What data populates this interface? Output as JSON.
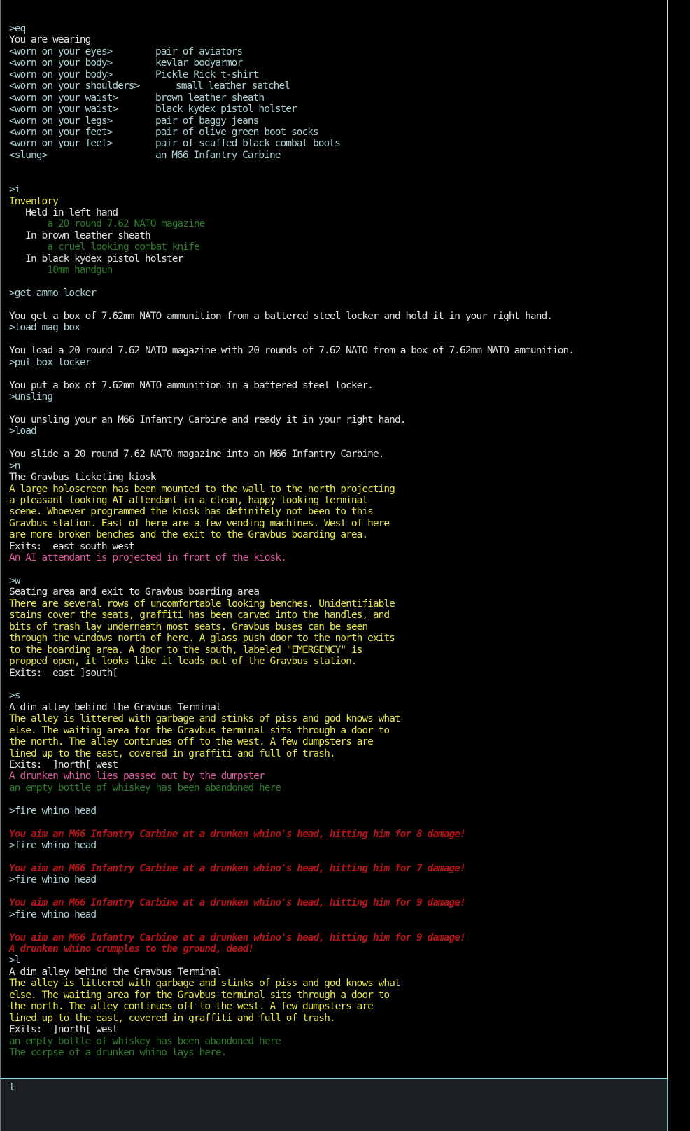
{
  "output": [
    {
      "style": "cmd",
      "text": ">eq"
    },
    {
      "style": "white",
      "text": "You are wearing"
    },
    {
      "style": "eq",
      "slot": "<worn on your eyes>",
      "item": "pair of aviators"
    },
    {
      "style": "eq",
      "slot": "<worn on your body>",
      "item": "kevlar bodyarmor"
    },
    {
      "style": "eq",
      "slot": "<worn on your body>",
      "item": "Pickle Rick t-shirt"
    },
    {
      "style": "eq",
      "slot": "<worn on your shoulders>",
      "item": "small leather satchel"
    },
    {
      "style": "eq",
      "slot": "<worn on your waist>",
      "item": "brown leather sheath"
    },
    {
      "style": "eq",
      "slot": "<worn on your waist>",
      "item": "black kydex pistol holster"
    },
    {
      "style": "eq",
      "slot": "<worn on your legs>",
      "item": "pair of baggy jeans"
    },
    {
      "style": "eq",
      "slot": "<worn on your feet>",
      "item": "pair of olive green boot socks"
    },
    {
      "style": "eq",
      "slot": "<worn on your feet>",
      "item": "pair of scuffed black combat boots"
    },
    {
      "style": "eq",
      "slot": "<slung>",
      "item": "an M66 Infantry Carbine"
    },
    {
      "style": "cmd",
      "text": ""
    },
    {
      "style": "cmd",
      "text": ""
    },
    {
      "style": "cmd",
      "text": ">i"
    },
    {
      "style": "yellow",
      "text": "Inventory"
    },
    {
      "style": "white",
      "text": "   Held in left hand"
    },
    {
      "style": "green",
      "text": "       a 20 round 7.62 NATO magazine"
    },
    {
      "style": "white",
      "text": "   In brown leather sheath"
    },
    {
      "style": "green",
      "text": "       a cruel looking combat knife"
    },
    {
      "style": "white",
      "text": "   In black kydex pistol holster"
    },
    {
      "style": "green",
      "text": "       10mm handgun"
    },
    {
      "style": "cmd",
      "text": ""
    },
    {
      "style": "cmd",
      "text": ">get ammo locker"
    },
    {
      "style": "cmd",
      "text": ""
    },
    {
      "style": "white",
      "text": "You get a box of 7.62mm NATO ammunition from a battered steel locker and hold it in your right hand."
    },
    {
      "style": "cmd",
      "text": ">load mag box"
    },
    {
      "style": "cmd",
      "text": ""
    },
    {
      "style": "white",
      "text": "You load a 20 round 7.62 NATO magazine with 20 rounds of 7.62 NATO from a box of 7.62mm NATO ammunition."
    },
    {
      "style": "cmd",
      "text": ">put box locker"
    },
    {
      "style": "cmd",
      "text": ""
    },
    {
      "style": "white",
      "text": "You put a box of 7.62mm NATO ammunition in a battered steel locker."
    },
    {
      "style": "cmd",
      "text": ">unsling"
    },
    {
      "style": "cmd",
      "text": ""
    },
    {
      "style": "white",
      "text": "You unsling your an M66 Infantry Carbine and ready it in your right hand."
    },
    {
      "style": "cmd",
      "text": ">load"
    },
    {
      "style": "cmd",
      "text": ""
    },
    {
      "style": "white",
      "text": "You slide a 20 round 7.62 NATO magazine into an M66 Infantry Carbine."
    },
    {
      "style": "cmd",
      "text": ">n"
    },
    {
      "style": "white",
      "text": "The Gravbus ticketing kiosk"
    },
    {
      "style": "yellow",
      "text": "A large holoscreen has been mounted to the wall to the north projecting"
    },
    {
      "style": "yellow",
      "text": "a pleasant looking AI attendant in a clean, happy looking terminal"
    },
    {
      "style": "yellow",
      "text": "scene. Whoever programmed the kiosk has definitely not been to this"
    },
    {
      "style": "yellow",
      "text": "Gravbus station. East of here are a few vending machines. West of here"
    },
    {
      "style": "yellow",
      "text": "are more broken benches and the exit to the Gravbus boarding area."
    },
    {
      "style": "white",
      "text": "Exits:  east south west"
    },
    {
      "style": "pink",
      "text": "An AI attendant is projected in front of the kiosk."
    },
    {
      "style": "cmd",
      "text": ""
    },
    {
      "style": "cmd",
      "text": ">w"
    },
    {
      "style": "white",
      "text": "Seating area and exit to Gravbus boarding area"
    },
    {
      "style": "yellow",
      "text": "There are several rows of uncomfortable looking benches. Unidentifiable"
    },
    {
      "style": "yellow",
      "text": "stains cover the seats, graffiti has been carved into the handles, and"
    },
    {
      "style": "yellow",
      "text": "bits of trash lay underneath most seats. Gravbus buses can be seen"
    },
    {
      "style": "yellow",
      "text": "through the windows north of here. A glass push door to the north exits"
    },
    {
      "style": "yellow",
      "text": "to the boarding area. A door to the south, labeled \"EMERGENCY\" is"
    },
    {
      "style": "yellow",
      "text": "propped open, it looks like it leads out of the Gravbus station."
    },
    {
      "style": "white",
      "text": "Exits:  east ]south["
    },
    {
      "style": "cmd",
      "text": ""
    },
    {
      "style": "cmd",
      "text": ">s"
    },
    {
      "style": "white",
      "text": "A dim alley behind the Gravbus Terminal"
    },
    {
      "style": "yellow",
      "text": "The alley is littered with garbage and stinks of piss and god knows what"
    },
    {
      "style": "yellow",
      "text": "else. The waiting area for the Gravbus terminal sits through a door to"
    },
    {
      "style": "yellow",
      "text": "the north. The alley continues off to the west. A few dumpsters are"
    },
    {
      "style": "yellow",
      "text": "lined up to the east, covered in graffiti and full of trash."
    },
    {
      "style": "white",
      "text": "Exits:  ]north[ west"
    },
    {
      "style": "pink",
      "text": "A drunken whino lies passed out by the dumpster"
    },
    {
      "style": "green",
      "text": "an empty bottle of whiskey has been abandoned here"
    },
    {
      "style": "cmd",
      "text": ""
    },
    {
      "style": "cmd",
      "text": ">fire whino head"
    },
    {
      "style": "cmd",
      "text": ""
    },
    {
      "style": "red",
      "text": "You aim an M66 Infantry Carbine at a drunken whino's head, hitting him for 8 damage!"
    },
    {
      "style": "cmd",
      "text": ">fire whino head"
    },
    {
      "style": "cmd",
      "text": ""
    },
    {
      "style": "red",
      "text": "You aim an M66 Infantry Carbine at a drunken whino's head, hitting him for 7 damage!"
    },
    {
      "style": "cmd",
      "text": ">fire whino head"
    },
    {
      "style": "cmd",
      "text": ""
    },
    {
      "style": "red",
      "text": "You aim an M66 Infantry Carbine at a drunken whino's head, hitting him for 9 damage!"
    },
    {
      "style": "cmd",
      "text": ">fire whino head"
    },
    {
      "style": "cmd",
      "text": ""
    },
    {
      "style": "red",
      "text": "You aim an M66 Infantry Carbine at a drunken whino's head, hitting him for 9 damage!"
    },
    {
      "style": "red",
      "text": "A drunken whino crumples to the ground, dead!"
    },
    {
      "style": "cmd",
      "text": ">l"
    },
    {
      "style": "white",
      "text": "A dim alley behind the Gravbus Terminal"
    },
    {
      "style": "yellow",
      "text": "The alley is littered with garbage and stinks of piss and god knows what"
    },
    {
      "style": "yellow",
      "text": "else. The waiting area for the Gravbus terminal sits through a door to"
    },
    {
      "style": "yellow",
      "text": "the north. The alley continues off to the west. A few dumpsters are"
    },
    {
      "style": "yellow",
      "text": "lined up to the east, covered in graffiti and full of trash."
    },
    {
      "style": "white",
      "text": "Exits:  ]north[ west"
    },
    {
      "style": "green",
      "text": "an empty bottle of whiskey has been abandoned here"
    },
    {
      "style": "green",
      "text": "The corpse of a drunken whino lays here."
    }
  ],
  "input": {
    "value": "l"
  },
  "colors": {
    "command": "#a9cfd2",
    "text": "#dfe3e3",
    "room_desc": "#e4e44a",
    "object": "#2f7a2c",
    "npc": "#e0589e",
    "combat": "#b3141a",
    "input_border": "#8fd0d4"
  }
}
